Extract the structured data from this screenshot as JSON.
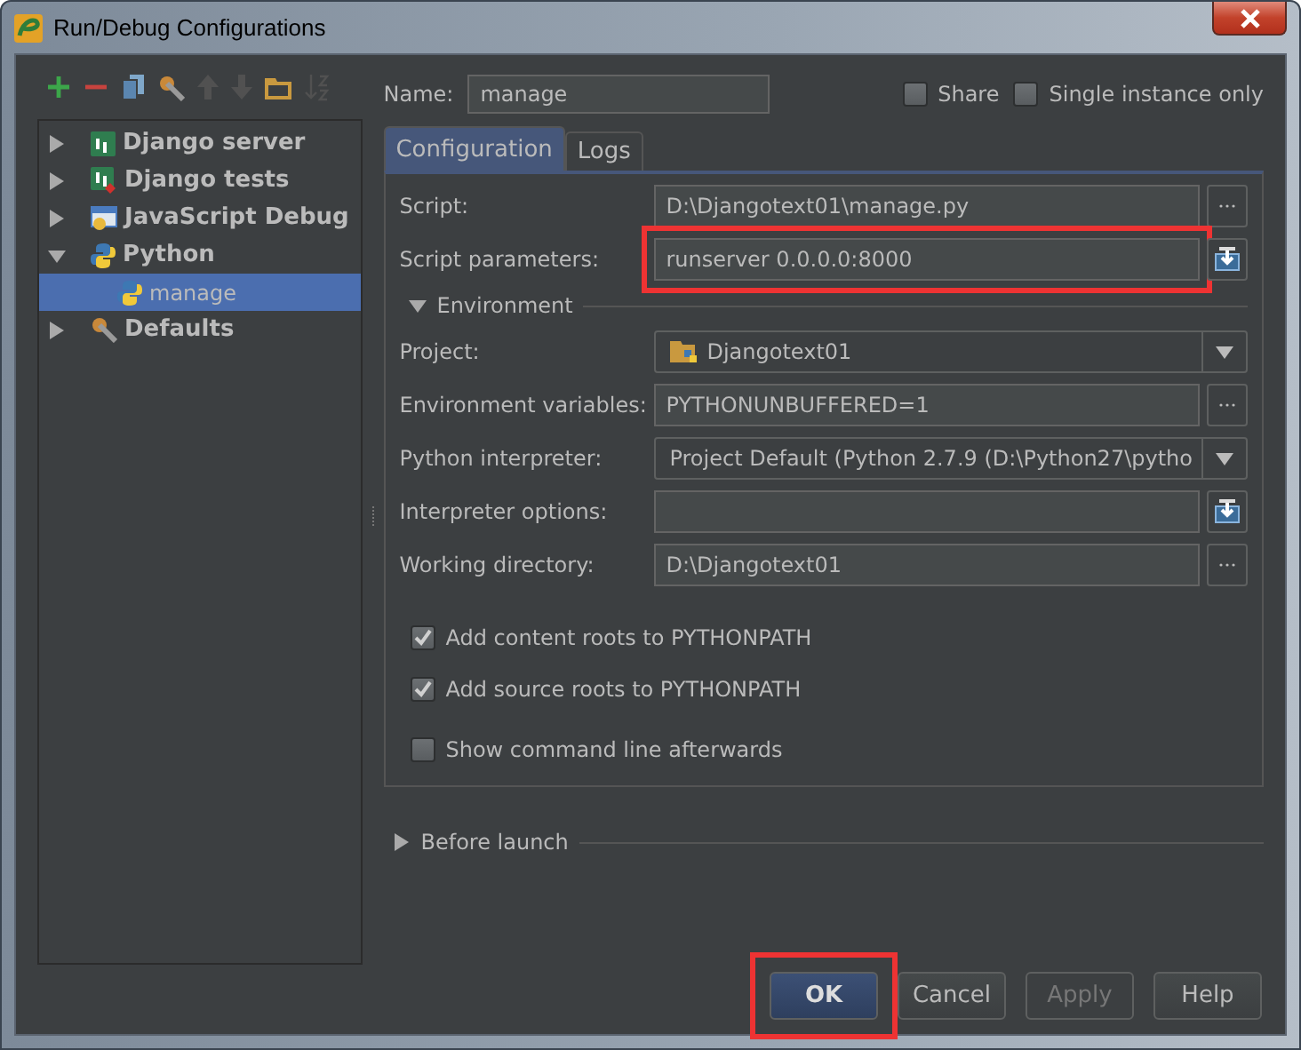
{
  "window": {
    "title": "Run/Debug Configurations"
  },
  "toolbar": [
    {
      "kind": "add",
      "disabled": false
    },
    {
      "kind": "remove",
      "disabled": false
    },
    {
      "kind": "copy",
      "disabled": false
    },
    {
      "kind": "wrench",
      "disabled": false
    },
    {
      "kind": "up",
      "disabled": true
    },
    {
      "kind": "down",
      "disabled": true
    },
    {
      "kind": "folder",
      "disabled": false
    },
    {
      "kind": "sort",
      "disabled": true
    }
  ],
  "tree": [
    {
      "label": "Django server",
      "kind": "django",
      "expanded": false,
      "selected": false
    },
    {
      "label": "Django tests",
      "kind": "django-tests",
      "expanded": false,
      "selected": false
    },
    {
      "label": "JavaScript Debug",
      "kind": "javascript",
      "expanded": false,
      "selected": false
    },
    {
      "label": "Python",
      "kind": "python",
      "expanded": true,
      "selected": false,
      "children": [
        {
          "label": "manage",
          "kind": "python",
          "selected": true
        }
      ]
    },
    {
      "label": "Defaults",
      "kind": "wrench",
      "expanded": false,
      "selected": false
    }
  ],
  "name": {
    "label": "Name:",
    "value": "manage"
  },
  "options": [
    {
      "label": "Share",
      "checked": false
    },
    {
      "label": "Single instance only",
      "checked": false
    }
  ],
  "tabs": [
    {
      "label": "Configuration",
      "selected": true
    },
    {
      "label": "Logs",
      "selected": false
    }
  ],
  "fields": [
    {
      "label": "Script:",
      "value": "D:\\Djangotext01\\manage.py",
      "kind": "browse",
      "highlighted": false
    },
    {
      "label": "Script parameters:",
      "value": "runserver 0.0.0.0:8000",
      "kind": "macro",
      "highlighted": true
    }
  ],
  "environment": {
    "label": "Environment",
    "expanded": true,
    "fields": [
      {
        "label": "Project:",
        "value": "Djangotext01",
        "kind": "project",
        "highlighted": false
      },
      {
        "label": "Environment variables:",
        "value": "PYTHONUNBUFFERED=1",
        "kind": "browse",
        "highlighted": false
      },
      {
        "label": "Python interpreter:",
        "value": "Project Default (Python 2.7.9 (D:\\Python27\\pytho",
        "kind": "combo",
        "highlighted": false
      },
      {
        "label": "Interpreter options:",
        "kind": "macro",
        "highlighted": false
      },
      {
        "label": "Working directory:",
        "value": "D:\\Djangotext01",
        "kind": "browse",
        "highlighted": false
      }
    ]
  },
  "checkboxes": [
    {
      "label": "Add content roots to PYTHONPATH",
      "checked": true
    },
    {
      "label": "Add source roots to PYTHONPATH",
      "checked": true
    },
    {
      "label": "Show command line afterwards",
      "checked": false
    }
  ],
  "before_launch": {
    "label": "Before launch",
    "expanded": false
  },
  "buttons": [
    {
      "label": "OK",
      "default": true,
      "disabled": false,
      "highlighted": true
    },
    {
      "label": "Cancel",
      "default": false,
      "disabled": false,
      "highlighted": false
    },
    {
      "label": "Apply",
      "default": false,
      "disabled": true,
      "highlighted": false
    },
    {
      "label": "Help",
      "default": false,
      "disabled": false,
      "highlighted": false
    }
  ]
}
